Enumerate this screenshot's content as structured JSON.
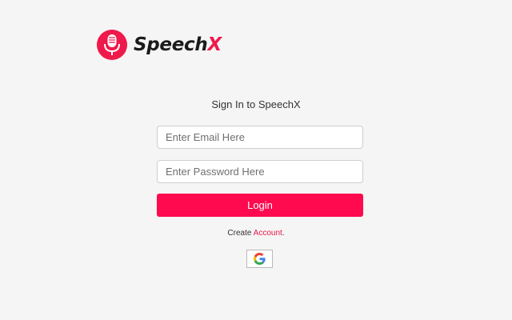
{
  "app": {
    "logo_text_main": "Speech",
    "logo_text_accent": "X"
  },
  "login": {
    "title": "Sign In to SpeechX",
    "email_placeholder": "Enter Email Here",
    "email_value": "",
    "password_placeholder": "Enter Password Here",
    "password_value": "",
    "login_label": "Login"
  },
  "signup": {
    "prefix": "Create",
    "link_label": "Account",
    "suffix": "."
  },
  "icons": {
    "logo": "microphone-icon",
    "google": "google-icon"
  },
  "colors": {
    "accent": "#ff0a4e",
    "link": "#e8174a",
    "background": "#f5f5f5"
  }
}
